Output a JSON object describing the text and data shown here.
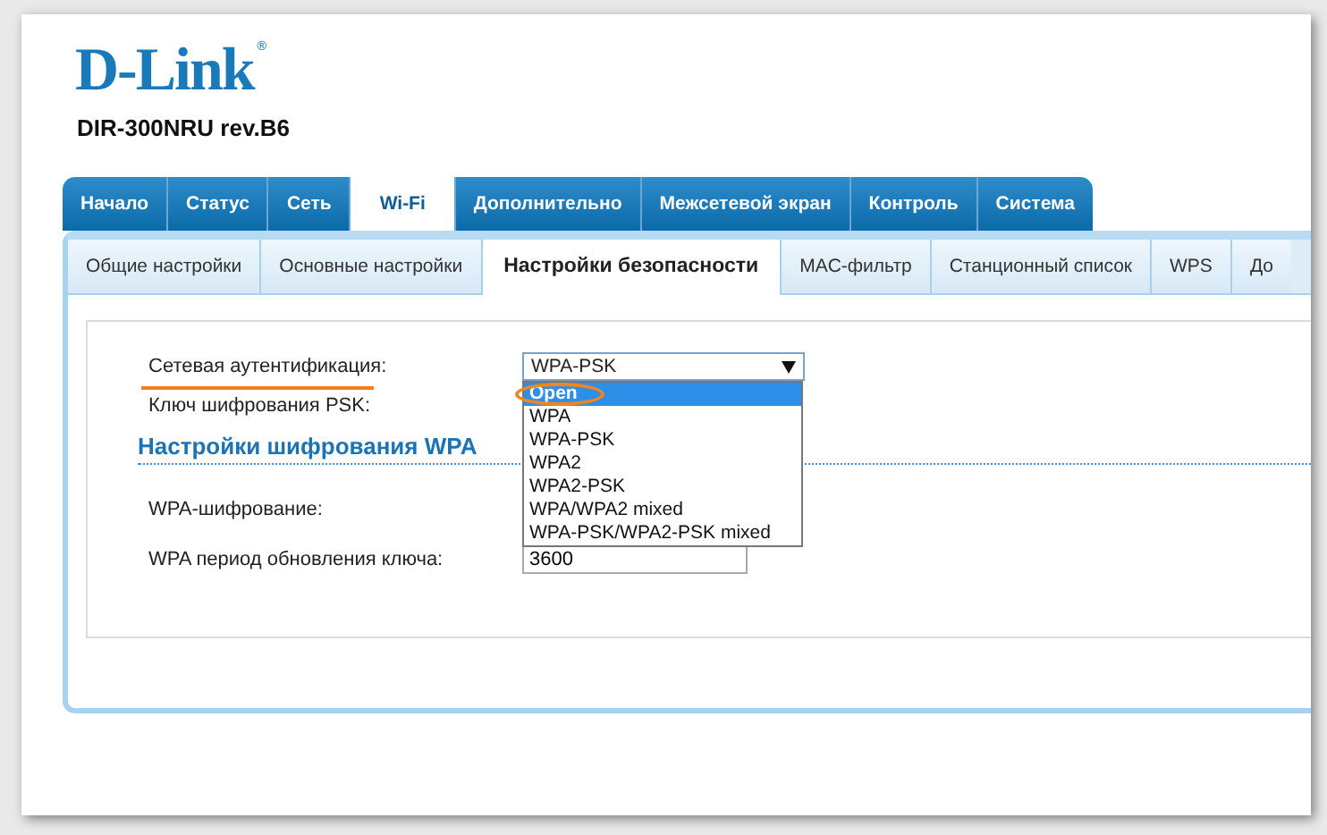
{
  "logo": {
    "brand": "D-Link",
    "trademark": "®",
    "model": "DIR-300NRU rev.B6"
  },
  "main_tabs": [
    {
      "label": "Начало",
      "selected": false
    },
    {
      "label": "Статус",
      "selected": false
    },
    {
      "label": "Сеть",
      "selected": false
    },
    {
      "label": "Wi-Fi",
      "selected": true
    },
    {
      "label": "Дополнительно",
      "selected": false
    },
    {
      "label": "Межсетевой экран",
      "selected": false
    },
    {
      "label": "Контроль",
      "selected": false
    },
    {
      "label": "Система",
      "selected": false
    }
  ],
  "sub_tabs": [
    {
      "label": "Общие настройки",
      "selected": false
    },
    {
      "label": "Основные настройки",
      "selected": false
    },
    {
      "label": "Настройки безопасности",
      "selected": true
    },
    {
      "label": "MAC-фильтр",
      "selected": false
    },
    {
      "label": "Станционный список",
      "selected": false
    },
    {
      "label": "WPS",
      "selected": false
    },
    {
      "label": "До",
      "selected": false
    }
  ],
  "auth": {
    "label": "Сетевая аутентификация:",
    "value": "WPA-PSK",
    "expanded": true,
    "options": [
      {
        "label": "Open",
        "highlighted": true
      },
      {
        "label": "WPA",
        "highlighted": false
      },
      {
        "label": "WPA-PSK",
        "highlighted": false
      },
      {
        "label": "WPA2",
        "highlighted": false
      },
      {
        "label": "WPA2-PSK",
        "highlighted": false
      },
      {
        "label": "WPA/WPA2 mixed",
        "highlighted": false
      },
      {
        "label": "WPA-PSK/WPA2-PSK mixed",
        "highlighted": false
      }
    ]
  },
  "psk": {
    "label": "Ключ шифрования PSK:"
  },
  "wpa_section": {
    "title": "Настройки шифрования WPA",
    "fields": [
      {
        "label": "WPA-шифрование:"
      },
      {
        "label": "WPA период обновления ключа:",
        "value": "3600"
      }
    ]
  }
}
